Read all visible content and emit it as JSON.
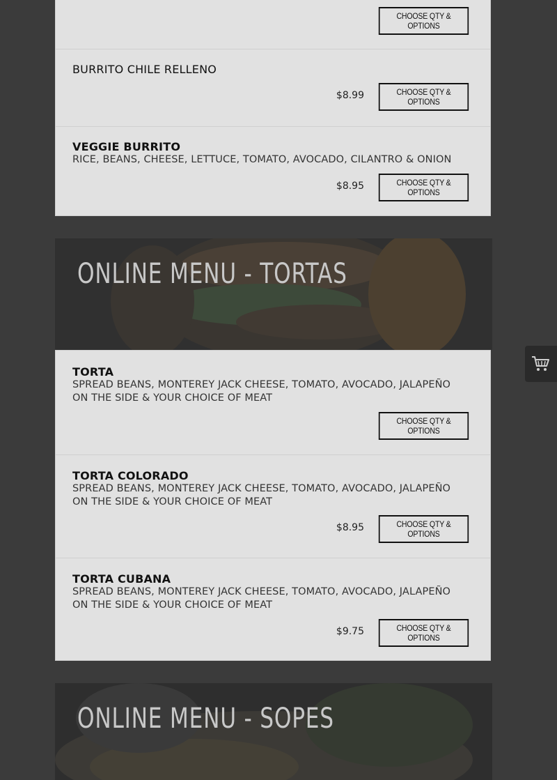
{
  "button_label": "CHOOSE QTY & OPTIONS",
  "burritos": {
    "items": [
      {
        "name": "",
        "desc": "",
        "price": ""
      },
      {
        "name": "BURRITO CHILE RELLENO",
        "desc": "",
        "price": "$8.99"
      },
      {
        "name": "VEGGIE BURRITO",
        "desc": "RICE, BEANS, CHEESE, LETTUCE, TOMATO, AVOCADO, CILANTRO & ONION",
        "price": "$8.95"
      }
    ]
  },
  "tortas": {
    "title": "ONLINE MENU - TORTAS",
    "items": [
      {
        "name": "TORTA",
        "desc": "SPREAD BEANS, MONTEREY JACK CHEESE, TOMATO, AVOCADO, JALAPEÑO ON THE SIDE & YOUR CHOICE OF MEAT",
        "price": ""
      },
      {
        "name": "TORTA COLORADO",
        "desc": "SPREAD BEANS, MONTEREY JACK CHEESE, TOMATO, AVOCADO, JALAPEÑO ON THE SIDE & YOUR CHOICE OF MEAT",
        "price": "$8.95"
      },
      {
        "name": "TORTA CUBANA",
        "desc": "SPREAD BEANS, MONTEREY JACK CHEESE, TOMATO, AVOCADO, JALAPEÑO ON THE SIDE & YOUR CHOICE OF MEAT",
        "price": "$9.75"
      }
    ]
  },
  "sopes": {
    "title": "ONLINE MENU - SOPES"
  },
  "icons": {
    "cart": "shopping-cart-icon"
  },
  "colors": {
    "overlay": "#3b3b3b",
    "panel": "#e1e1e1",
    "banner_text": "#c8c8c8"
  }
}
